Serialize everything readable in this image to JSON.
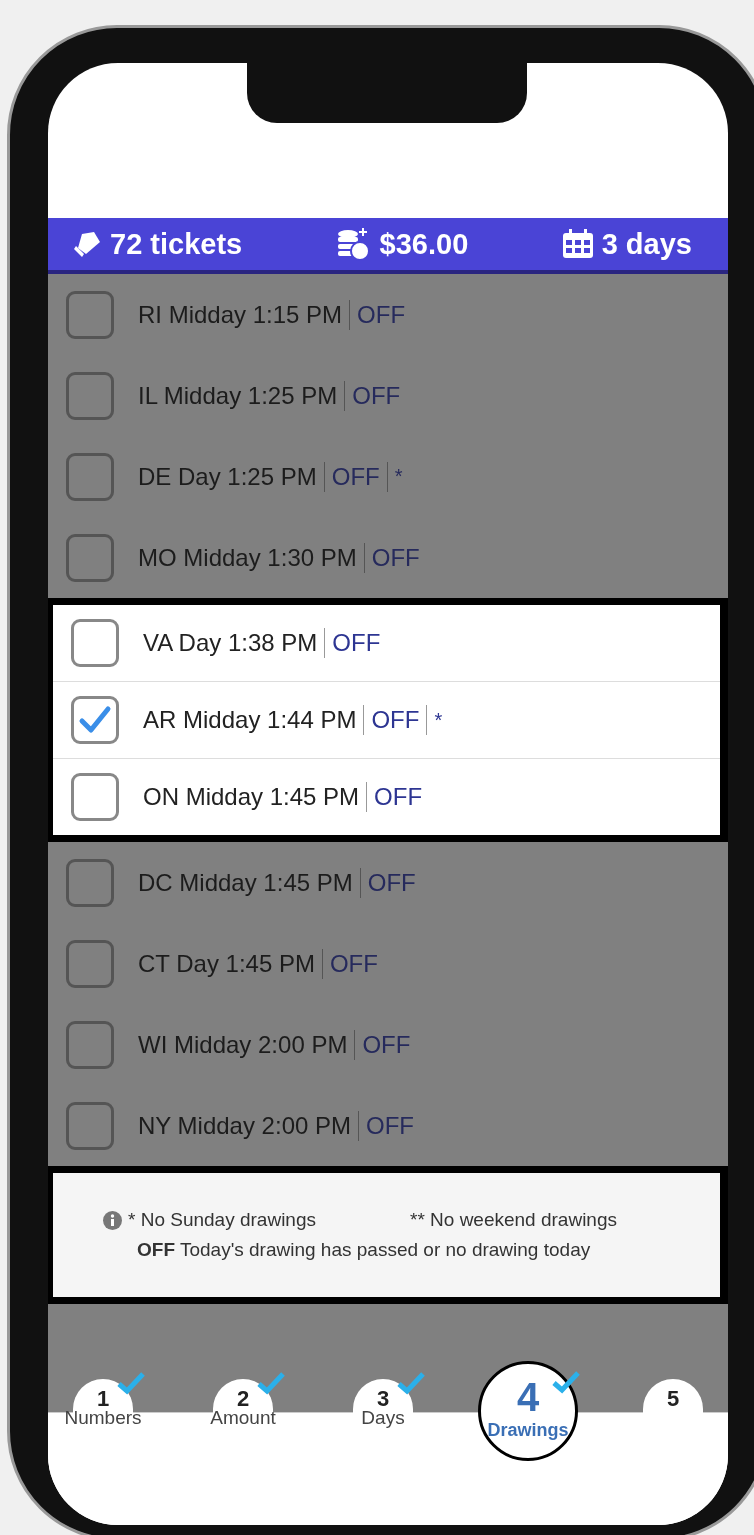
{
  "summary": {
    "tickets": "72 tickets",
    "amount": "$36.00",
    "days": "3 days"
  },
  "sections": [
    {
      "highlighted": false,
      "rows": [
        {
          "label": "RI Midday 1:15 PM",
          "status": "OFF",
          "checked": false
        },
        {
          "label": "IL Midday 1:25 PM",
          "status": "OFF",
          "checked": false
        },
        {
          "label": "DE Day 1:25 PM",
          "status": "OFF",
          "note": "*",
          "checked": false
        },
        {
          "label": "MO Midday 1:30 PM",
          "status": "OFF",
          "checked": false
        }
      ]
    },
    {
      "highlighted": true,
      "rows": [
        {
          "label": "VA Day 1:38 PM",
          "status": "OFF",
          "checked": false
        },
        {
          "label": "AR Midday 1:44 PM",
          "status": "OFF",
          "note": "*",
          "checked": true
        },
        {
          "label": "ON Midday 1:45 PM",
          "status": "OFF",
          "checked": false
        }
      ]
    },
    {
      "highlighted": false,
      "rows": [
        {
          "label": "DC Midday 1:45 PM",
          "status": "OFF",
          "checked": false
        },
        {
          "label": "CT Day 1:45 PM",
          "status": "OFF",
          "checked": false
        },
        {
          "label": "WI Midday 2:00 PM",
          "status": "OFF",
          "checked": false
        },
        {
          "label": "NY Midday 2:00 PM",
          "status": "OFF",
          "checked": false
        }
      ]
    }
  ],
  "legend": {
    "sunday": "* No Sunday drawings",
    "weekend": "** No weekend drawings",
    "off": "**OFF** Today's drawing has passed or no drawing today"
  },
  "steps": [
    {
      "number": "1",
      "label": "Numbers",
      "done": true,
      "selected": false
    },
    {
      "number": "2",
      "label": "Amount",
      "done": true,
      "selected": false
    },
    {
      "number": "3",
      "label": "Days",
      "done": true,
      "selected": false
    },
    {
      "number": "4",
      "label": "Drawings",
      "done": true,
      "selected": true
    },
    {
      "number": "5",
      "done": false,
      "selected": false
    }
  ]
}
